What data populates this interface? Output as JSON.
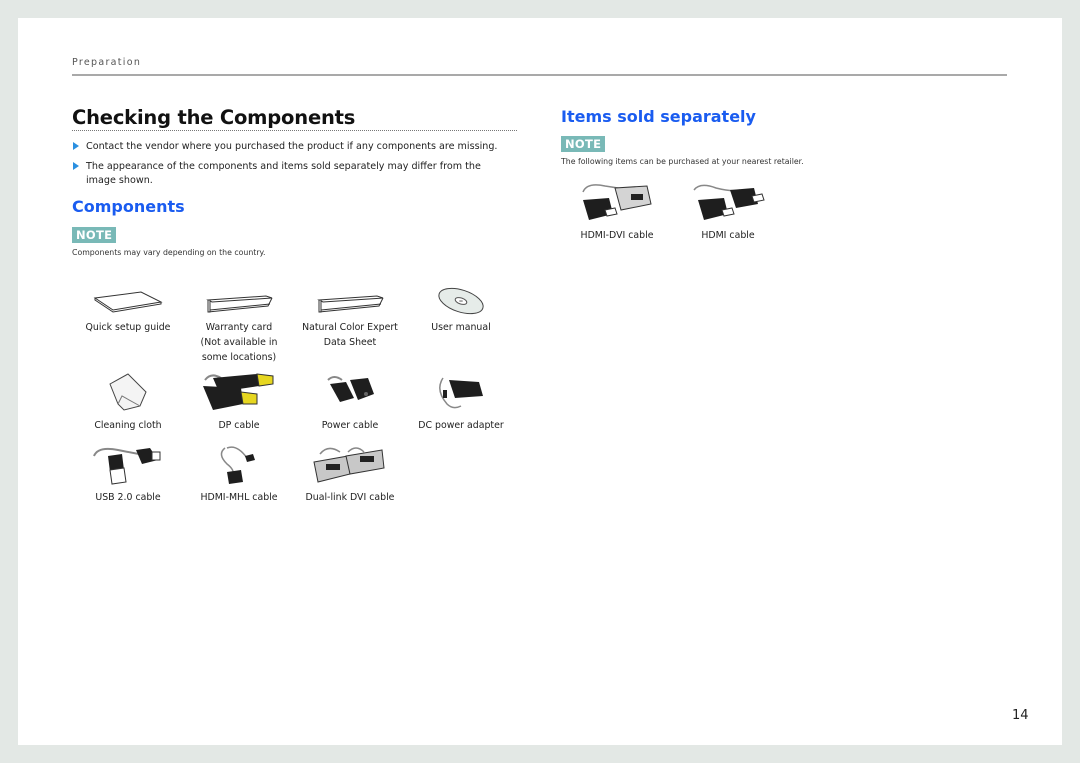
{
  "header": {
    "section": "Preparation"
  },
  "title": "Checking the Components",
  "bullets": [
    "Contact the vendor where you purchased the product if any components are missing.",
    "The appearance of the components and items sold separately may differ from the image shown."
  ],
  "components": {
    "heading": "Components",
    "note_badge": "NOTE",
    "note_text": "Components may vary depending on the country.",
    "items": [
      {
        "label": "Quick setup guide",
        "icon": "booklet-icon"
      },
      {
        "label": "Warranty card\n(Not available in\nsome locations)",
        "icon": "card-icon"
      },
      {
        "label": "Natural Color Expert\nData Sheet",
        "icon": "data-sheet-icon"
      },
      {
        "label": "User manual",
        "icon": "cd-icon"
      },
      {
        "label": "Cleaning cloth",
        "icon": "cloth-icon"
      },
      {
        "label": "DP cable",
        "icon": "dp-cable-icon"
      },
      {
        "label": "Power cable",
        "icon": "power-cable-icon"
      },
      {
        "label": "DC power adapter",
        "icon": "power-adapter-icon"
      },
      {
        "label": "USB 2.0 cable",
        "icon": "usb-cable-icon"
      },
      {
        "label": "HDMI-MHL cable",
        "icon": "hdmi-mhl-cable-icon"
      },
      {
        "label": "Dual-link DVI cable",
        "icon": "dvi-cable-icon"
      }
    ]
  },
  "sold_separately": {
    "heading": "Items sold separately",
    "note_badge": "NOTE",
    "note_text": "The following items can be purchased at your nearest retailer.",
    "items": [
      {
        "label": "HDMI-DVI cable",
        "icon": "hdmi-dvi-cable-icon"
      },
      {
        "label": "HDMI cable",
        "icon": "hdmi-cable-icon"
      }
    ]
  },
  "page_number": "14",
  "colors": {
    "heading_blue": "#1a5cf0",
    "note_teal": "#79b9b7",
    "bullet_blue": "#2a8fe0",
    "background": "#e3e8e5"
  }
}
